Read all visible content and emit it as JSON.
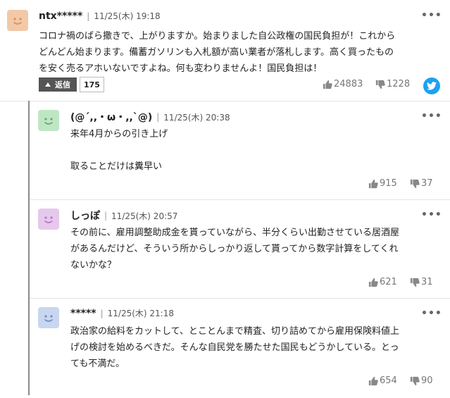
{
  "top": {
    "username": "ntx*****",
    "date": "11/25(木) 19:18",
    "text_lines": [
      "コロナ禍のばら撒きで、上がりますか。始まりました自公政権の国民負担が！これから",
      "どんどん始まります。備蓄ガソリンも入札額が高い業者が落札します。高く買ったもの",
      "を安く売るアホいないですよね。何も変わりませんよ！国民負担は！"
    ],
    "reply_label": "返信",
    "reply_count": "175",
    "likes": "24883",
    "dislikes": "1228",
    "avatar_color": "#f2c9a8"
  },
  "replies": [
    {
      "username": "(@´,,・ω・,,`@)",
      "date": "11/25(木) 20:38",
      "text_lines": [
        "来年4月からの引き上げ",
        "",
        "取ることだけは糞早い"
      ],
      "likes": "915",
      "dislikes": "37",
      "avatar_color": "#bfe6c4"
    },
    {
      "username": "しっぽ",
      "date": "11/25(木) 20:57",
      "text_lines": [
        "その前に、雇用調整助成金を貰っていながら、半分くらい出勤させている居酒屋",
        "があるんだけど、そういう所からしっかり返して貰ってから数字計算をしてくれ",
        "ないかな？"
      ],
      "likes": "621",
      "dislikes": "31",
      "avatar_color": "#e6c8ec"
    },
    {
      "username": "*****",
      "date": "11/25(木) 21:18",
      "text_lines": [
        "政治家の給料をカットして、とことんまで精査、切り詰めてから雇用保険料値上",
        "げの検討を始めるべきだ。そんな自民党を勝たせた国民もどうかしている。とっ",
        "ても不満だ。"
      ],
      "likes": "654",
      "dislikes": "90",
      "avatar_color": "#c8d6f0"
    }
  ],
  "icons": {
    "more": "more-options-icon",
    "like": "thumbs-up-icon",
    "dislike": "thumbs-down-icon",
    "share": "twitter-icon",
    "reply_arrow": "caret-up-icon"
  }
}
